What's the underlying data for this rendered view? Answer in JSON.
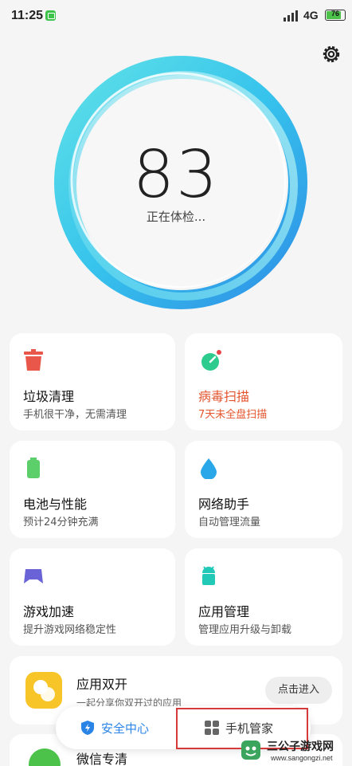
{
  "status_bar": {
    "time": "11:25",
    "network": "4G",
    "battery": "76"
  },
  "score": {
    "value": "83",
    "status": "正在体检..."
  },
  "cards": [
    {
      "title": "垃圾清理",
      "sub": "手机很干净，无需清理",
      "icon": "trash-icon",
      "color": "#e8574a"
    },
    {
      "title": "病毒扫描",
      "sub": "7天未全盘扫描",
      "icon": "virus-scan-icon",
      "color": "#2ecb8e",
      "alert": true
    },
    {
      "title": "电池与性能",
      "sub": "预计24分钟充满",
      "icon": "battery-icon",
      "color": "#5dcf6a"
    },
    {
      "title": "网络助手",
      "sub": "自动管理流量",
      "icon": "water-drop-icon",
      "color": "#2aa7e8"
    },
    {
      "title": "游戏加速",
      "sub": "提升游戏网络稳定性",
      "icon": "gamepad-icon",
      "color": "#6a63d8"
    },
    {
      "title": "应用管理",
      "sub": "管理应用升级与卸载",
      "icon": "android-icon",
      "color": "#23c9b7"
    }
  ],
  "dual_app": {
    "title": "应用双开",
    "sub": "一起分享你双开过的应用",
    "button": "点击进入"
  },
  "wechat_clean": {
    "title": "微信专清"
  },
  "bottom_nav": {
    "security": "安全中心",
    "manager": "手机管家"
  },
  "watermark": {
    "name": "三公子游戏网",
    "url": "www.sangongzi.net"
  },
  "colors": {
    "accent": "#2a84e6",
    "alert": "#e4552f",
    "highlight": "#d43a3a"
  }
}
